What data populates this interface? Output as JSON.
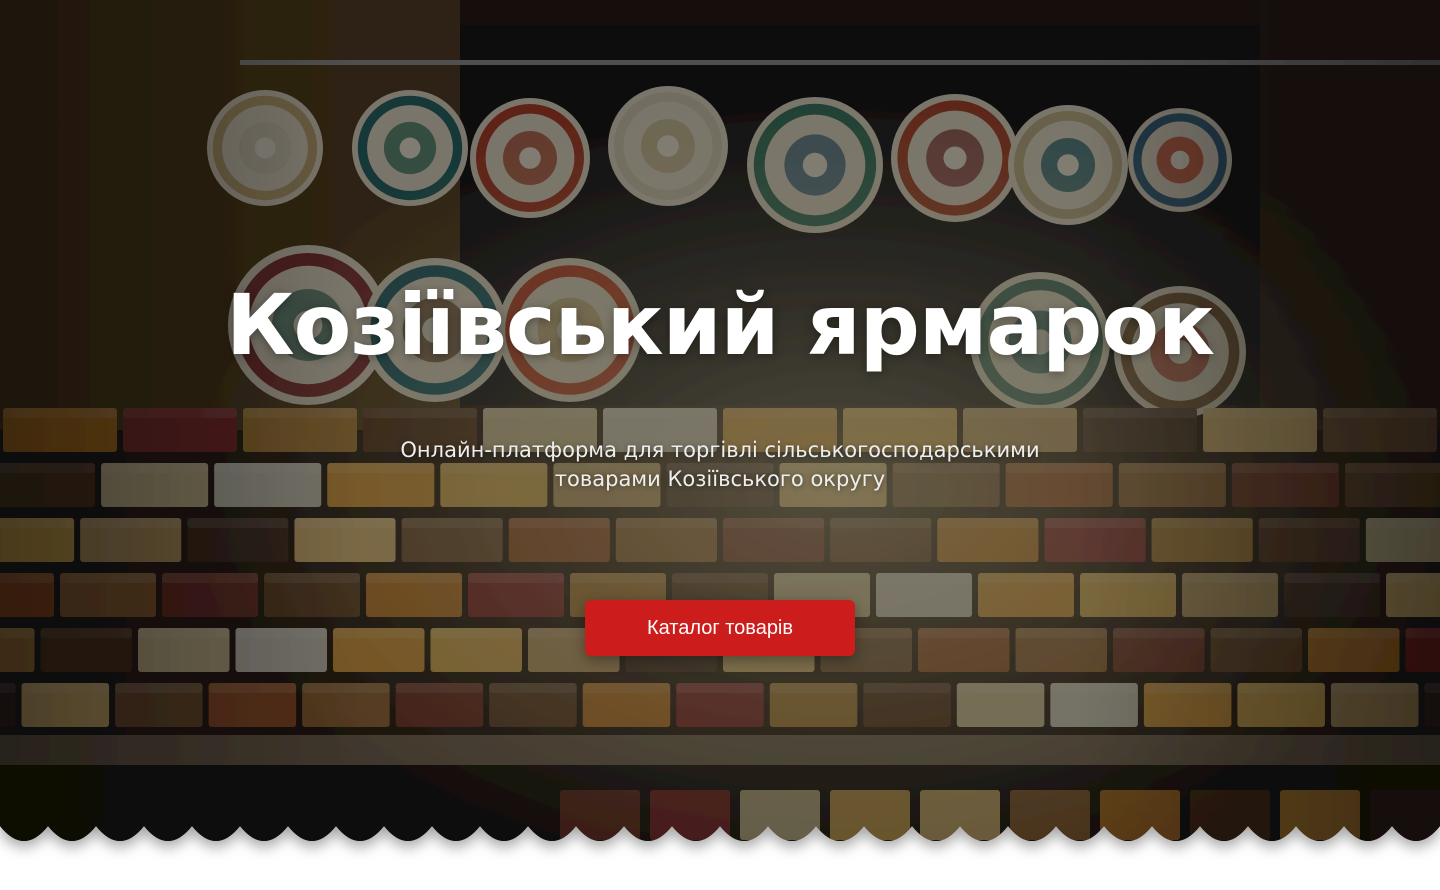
{
  "hero": {
    "title": "Козіївський ярмарок",
    "subtitle_line1": "Онлайн-платформа для торгівлі сільськогосподарськими",
    "subtitle_line2": "товарами Козіївського округу",
    "catalog_button_label": "Каталог товарів",
    "background_image": "market-stall-photo"
  },
  "colors": {
    "accent_button": "#cc1c1c",
    "title_text": "#ffffff",
    "subtitle_text": "#eeeeee",
    "page_background": "#ffffff"
  }
}
